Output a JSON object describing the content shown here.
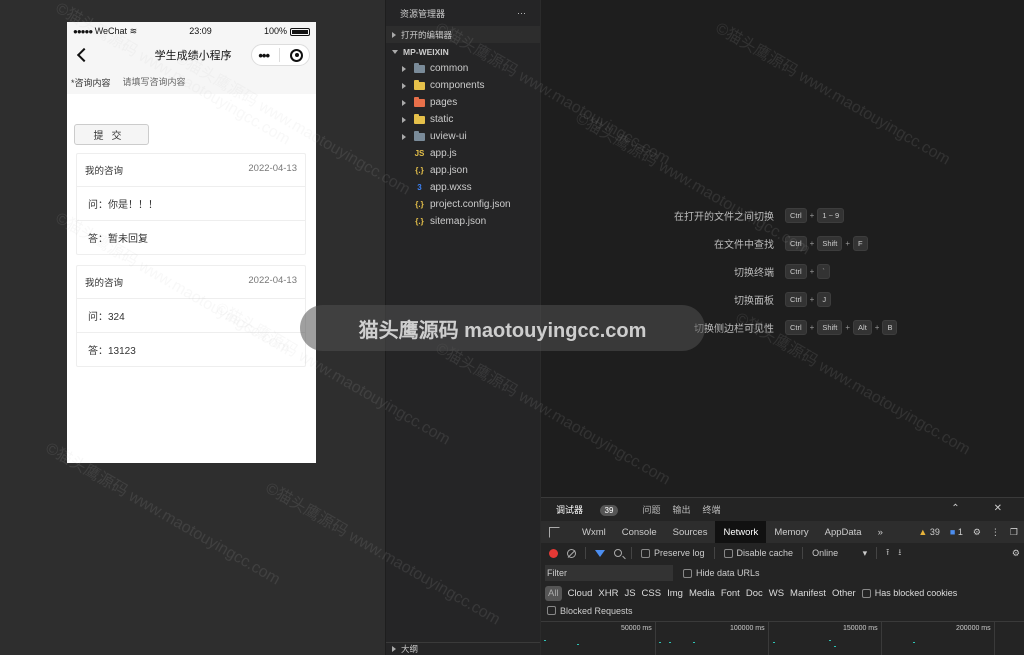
{
  "phone": {
    "status": {
      "carrier": "WeChat",
      "time": "23:09",
      "battery": "100%"
    },
    "nav": {
      "title": "学生成绩小程序"
    },
    "form": {
      "label": "*咨询内容",
      "placeholder": "请填写咨询内容"
    },
    "submit_label": "提交",
    "cards": [
      {
        "header": "我的咨询",
        "date": "2022-04-13",
        "question": "问：你是！！！",
        "answer": "答：暂未回复"
      },
      {
        "header": "我的咨询",
        "date": "2022-04-13",
        "question": "问：324",
        "answer": "答：13123"
      }
    ]
  },
  "explorer": {
    "title": "资源管理器",
    "more": "···",
    "open_editors": "打开的编辑器",
    "root": "MP-WEIXIN",
    "folders": [
      {
        "name": "common",
        "color": "#7a8b99"
      },
      {
        "name": "components",
        "color": "#e5c04a"
      },
      {
        "name": "pages",
        "color": "#e8704a"
      },
      {
        "name": "static",
        "color": "#e5c04a"
      },
      {
        "name": "uview-ui",
        "color": "#7a8b99"
      }
    ],
    "files": [
      {
        "name": "app.js",
        "icon": "JS",
        "color": "#e5c04a"
      },
      {
        "name": "app.json",
        "icon": "{.}",
        "color": "#e5c04a"
      },
      {
        "name": "app.wxss",
        "icon": "3",
        "color": "#3b82f6"
      },
      {
        "name": "project.config.json",
        "icon": "{.}",
        "color": "#e5c04a"
      },
      {
        "name": "sitemap.json",
        "icon": "{.}",
        "color": "#e5c04a"
      }
    ],
    "outline": "大纲"
  },
  "shortcuts": [
    {
      "label": "在打开的文件之间切换",
      "keys": [
        "Ctrl",
        "1 ~ 9"
      ]
    },
    {
      "label": "在文件中查找",
      "keys": [
        "Ctrl",
        "Shift",
        "F"
      ]
    },
    {
      "label": "切换终端",
      "keys": [
        "Ctrl",
        "`"
      ]
    },
    {
      "label": "切换面板",
      "keys": [
        "Ctrl",
        "J"
      ]
    },
    {
      "label": "切换侧边栏可见性",
      "keys": [
        "Ctrl",
        "Shift",
        "Alt",
        "B"
      ]
    }
  ],
  "devtools": {
    "top_tabs": {
      "debugger": "调试器",
      "debugger_count": "39",
      "issues": "问题",
      "output": "输出",
      "terminal": "终端"
    },
    "tabs": [
      "Wxml",
      "Console",
      "Sources",
      "Network",
      "Memory",
      "AppData"
    ],
    "overflow": "»",
    "warnings": "39",
    "messages": "1",
    "toolbar": {
      "preserve_log": "Preserve log",
      "disable_cache": "Disable cache",
      "throttle": "Online"
    },
    "filter_placeholder": "Filter",
    "hide_data_urls": "Hide data URLs",
    "types": [
      "All",
      "Cloud",
      "XHR",
      "JS",
      "CSS",
      "Img",
      "Media",
      "Font",
      "Doc",
      "WS",
      "Manifest",
      "Other"
    ],
    "has_blocked_cookies": "Has blocked cookies",
    "blocked_requests": "Blocked Requests",
    "timeline_ticks": [
      "50000 ms",
      "100000 ms",
      "150000 ms",
      "200000 ms"
    ]
  },
  "watermark": "猫头鹰源码 maotouyingcc.com",
  "watermark_repeat": "©猫头鹰源码 www.maotouyingcc.com"
}
